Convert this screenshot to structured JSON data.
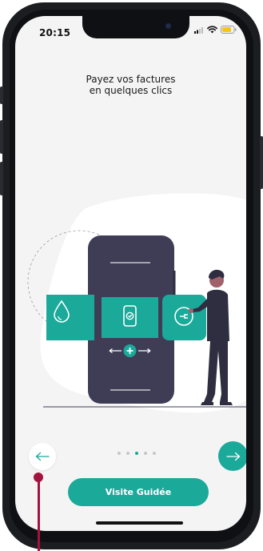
{
  "status_bar": {
    "time": "20:15",
    "icons": [
      "signal-icon",
      "wifi-icon",
      "battery-icon"
    ]
  },
  "onboarding": {
    "title_line1": "Payez vos factures",
    "title_line2": "en quelques clics",
    "illustration_icons": [
      "water-drop-icon",
      "phone-check-icon",
      "plug-icon",
      "plus-icon"
    ],
    "pagination": {
      "total": 5,
      "current": 3
    },
    "cta_label": "Visite Guidée"
  },
  "navigation": {
    "prev_icon": "arrow-left-icon",
    "next_icon": "arrow-right-icon"
  },
  "colors": {
    "accent": "#1ba99a",
    "phone_body": "#3f3d56",
    "annotation": "#a4123f",
    "screen_bg": "#f4f4f4"
  }
}
